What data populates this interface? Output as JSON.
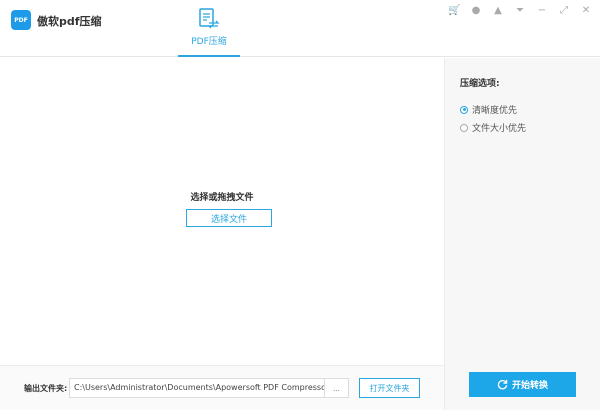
{
  "app": {
    "title": "傲软pdf压缩",
    "logo_text": "PDF"
  },
  "tabs": [
    {
      "label": "PDF压缩",
      "active": true
    }
  ],
  "window_icons": [
    "cart-icon",
    "user-icon",
    "bell-icon",
    "menu-icon",
    "minimize-icon",
    "maximize-icon",
    "close-icon"
  ],
  "window_glyphs": [
    "🛒",
    "●",
    "▲",
    "⏷",
    "−",
    "⤢",
    "✕"
  ],
  "main": {
    "drop_text": "选择或拖拽文件",
    "select_button": "选择文件"
  },
  "side": {
    "title": "压缩选项:",
    "options": [
      {
        "label": "清晰度优先",
        "selected": true
      },
      {
        "label": "文件大小优先",
        "selected": false
      }
    ]
  },
  "bottom": {
    "output_label": "输出文件夹:",
    "output_path": "C:\\Users\\Administrator\\Documents\\Apowersoft PDF Compressor",
    "browse_label": "...",
    "open_folder": "打开文件夹"
  },
  "start_button": "开始转换",
  "colors": {
    "accent": "#2aa6e0",
    "start": "#1ea7e8"
  }
}
